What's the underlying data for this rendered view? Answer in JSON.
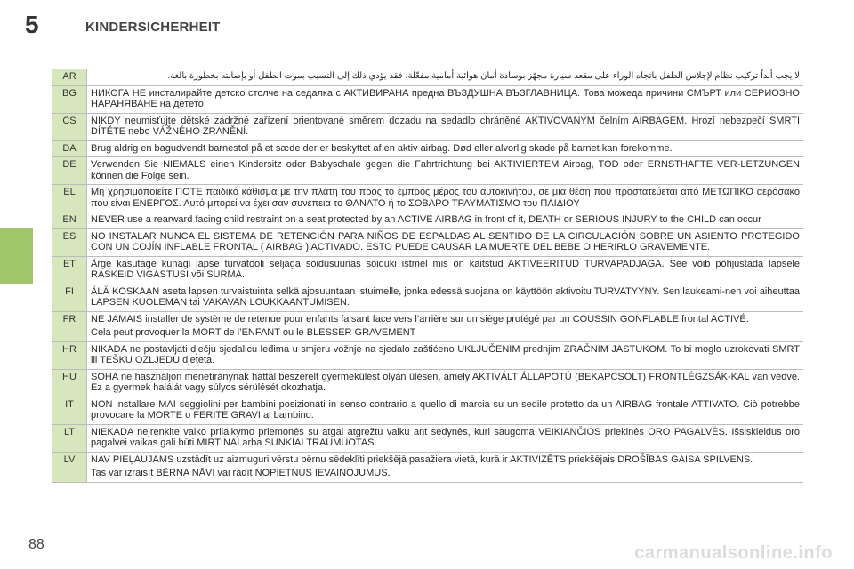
{
  "header": {
    "chapter_number": "5",
    "chapter_title": "KINDERSICHERHEIT"
  },
  "page_number": "88",
  "watermark": "carmanualsonline.info",
  "warnings": [
    {
      "code": "AR",
      "paras": [
        "لا يجب أبداً تركيب نظام لإجلاس الطفل باتجاه الوراء على مقعد سيارة مجهّز بوسادة أمان هوائية أمامية مفعّلة، فقد يؤدي ذلك إلى التسبب بموت الطفل أو بإصابته بخطورة بالغة."
      ]
    },
    {
      "code": "BG",
      "paras": [
        "НИКОГА НЕ инсталирайте детско столче на седалка с АКТИВИРАНА предна ВЪЗДУШНА ВЪЗГЛАВНИЦА. Това можеда причини СМЪРТ или СЕРИОЗНО НАРАНЯВАНЕ на детето."
      ]
    },
    {
      "code": "CS",
      "paras": [
        "NIKDY neumisťujte dětské zádržné zařízení orientované směrem dozadu na sedadlo chráněné AKTIVOVANÝM čelním AIRBAGEM. Hrozí nebezpečí SMRTI DÍTĚTE nebo VÁŽNÉHO ZRANĚNÍ."
      ]
    },
    {
      "code": "DA",
      "paras": [
        "Brug aldrig en bagudvendt barnestol på et sæde der er beskyttet af en aktiv airbag. Død eller alvorlig skade på barnet kan forekomme."
      ]
    },
    {
      "code": "DE",
      "paras": [
        "Verwenden Sie NIEMALS einen Kindersitz oder Babyschale gegen die Fahrtrichtung bei AKTIVIERTEM Airbag, TOD oder ERNSTHAFTE VER-LETZUNGEN können die Folge sein."
      ]
    },
    {
      "code": "EL",
      "paras": [
        "Μη χρησιμοποιείτε ΠΟΤΕ παιδικό κάθισμα με την πλάτη του προς το εμπρός μέρος του αυτοκινήτου, σε μια θέση που προστατεύεται από ΜΕΤΩΠΙΚΟ αερόσακο που είναι ΕΝΕΡΓΟΣ. Αυτό μπορεί να έχει σαν συνέπεια το ΘΑΝΑΤΟ ή το ΣΟΒΑΡΟ ΤΡΑΥΜΑΤΙΣΜΟ του ΠΑΙΔΙΟΥ"
      ]
    },
    {
      "code": "EN",
      "paras": [
        "NEVER use a rearward facing child restraint on a seat protected by an ACTIVE AIRBAG in front of it, DEATH or SERIOUS INJURY to the CHILD can occur"
      ]
    },
    {
      "code": "ES",
      "paras": [
        "NO INSTALAR NUNCA EL SISTEMA DE RETENCIÓN PARA NIÑOS DE ESPALDAS AL SENTIDO DE LA CIRCULACIÓN SOBRE UN ASIENTO PROTEGIDO CON UN COJÍN INFLABLE FRONTAL ( AIRBAG ) ACTIVADO. ESTO PUEDE CAUSAR LA MUERTE DEL BEBE O HERIRLO GRAVEMENTE."
      ]
    },
    {
      "code": "ET",
      "paras": [
        "Ärge kasutage kunagi lapse turvatooli seljaga sõidusuunas sõiduki istmel mis on kaitstud AKTIVEERITUD TURVAPADJAGA. See võib põhjustada lapsele RASKEID VIGASTUSI või SURMA."
      ]
    },
    {
      "code": "FI",
      "paras": [
        "ÄLÄ KOSKAAN aseta lapsen turvaistuinta selkä ajosuuntaan istuimelle, jonka edessä suojana on käyttöön aktivoitu TURVATYYNY. Sen laukeami-nen voi aiheuttaa LAPSEN KUOLEMAN tai VAKAVAN LOUKKAANTUMISEN."
      ]
    },
    {
      "code": "FR",
      "paras": [
        "NE JAMAIS installer de système de retenue pour enfants faisant face vers l’arrière sur un siège protégé par un COUSSIN GONFLABLE frontal ACTIVÉ.",
        "Cela peut provoquer la MORT de l’ENFANT ou le BLESSER GRAVEMENT"
      ]
    },
    {
      "code": "HR",
      "paras": [
        "NIKADA ne postavljati dječju sjedalicu leđima u smjeru vožnje na sjedalo zaštićeno UKLJUČENIM prednjim ZRAČNIM JASTUKOM. To bi moglo uzrokovati SMRT ili TEŠKU OZLJEDU djeteta."
      ]
    },
    {
      "code": "HU",
      "paras": [
        "SOHA ne használjon menetiránynak háttal beszerelt gyermekülést olyan ülésen, amely AKTIVÁLT ÁLLAPOTÚ (BEKAPCSOLT) FRONTLÉGZSÁK-KAL van védve. Ez a gyermek halálát vagy súlyos sérülését okozhatja."
      ]
    },
    {
      "code": "IT",
      "paras": [
        "NON installare MAI seggiolini per bambini posizionati in senso contrario a quello di marcia su un sedile protetto da un AIRBAG frontale ATTIVATO. Ciò potrebbe provocare la MORTE o FERITE GRAVI al bambino."
      ]
    },
    {
      "code": "LT",
      "paras": [
        "NIEKADA neįrenkite vaiko prilaikymo priemonės su atgal atgręžtu vaiku ant sėdynės, kuri saugoma VEIKIANČIOS priekinės ORO PAGALVĖS. Išsiskleidus oro pagalvei vaikas gali būti MIRTINAI arba SUNKIAI TRAUMUOTAS."
      ]
    },
    {
      "code": "LV",
      "paras": [
        "NAV PIEĻAUJAMS uzstādīt uz aizmuguri vērstu bērnu sēdeklīti priekšējā pasažiera  vietā, kurā ir AKTIVIZĒTS priekšējais DROŠĪBAS GAISA SPILVENS.",
        "Tas var izraisīt BĒRNA NĀVI vai radīt NOPIETNUS IEVAINOJUMUS."
      ]
    }
  ]
}
